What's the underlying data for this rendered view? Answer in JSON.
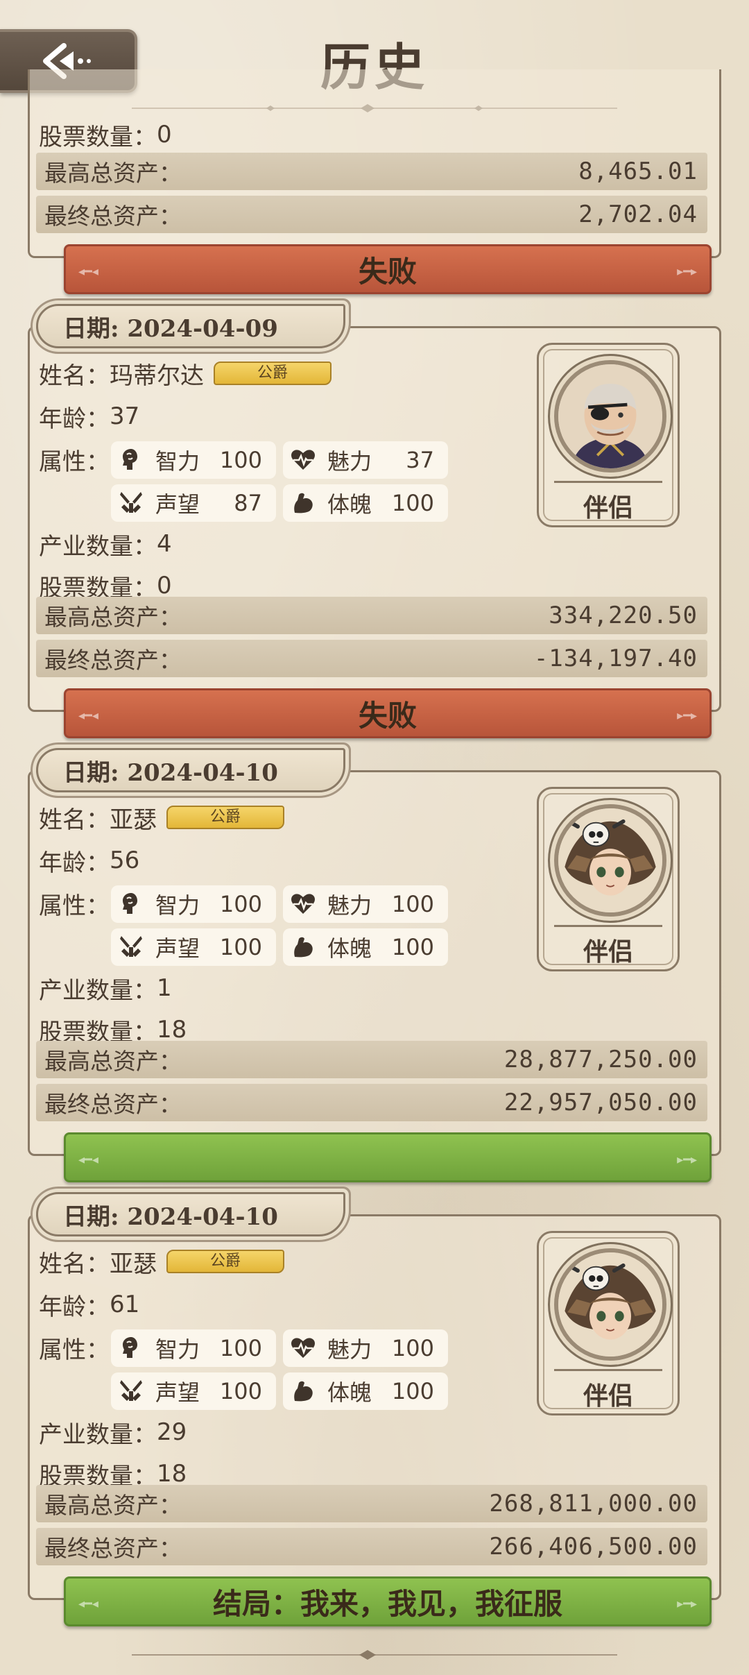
{
  "header": {
    "title": "历史"
  },
  "labels": {
    "name": "姓名：",
    "age": "年龄：",
    "attrs": "属性：",
    "industry": "产业数量：",
    "stock": "股票数量：",
    "max_assets": "最高总资产：",
    "final_assets": "最终总资产：",
    "partner": "伴侣",
    "int": "智力",
    "cha": "魅力",
    "rep": "声望",
    "phy": "体魄"
  },
  "colors": {
    "fail": "#c4603f",
    "win": "#7db345",
    "badge": "#eec74f"
  },
  "records": [
    {
      "stock": "0",
      "max_assets": "8,465.01",
      "final_assets": "2,702.04",
      "result": "失败"
    },
    {
      "date": "日期: 2024-04-09",
      "name": "玛蒂尔达",
      "title": "公爵",
      "age": "37",
      "int": "100",
      "cha": "37",
      "rep": "87",
      "phy": "100",
      "industry": "4",
      "stock": "0",
      "max_assets": "334,220.50",
      "final_assets": "-134,197.40",
      "result": "失败",
      "partner_icon": "eyepatch-man-portrait"
    },
    {
      "date": "日期: 2024-04-10",
      "name": "亚瑟",
      "title": "公爵",
      "age": "56",
      "int": "100",
      "cha": "100",
      "rep": "100",
      "phy": "100",
      "industry": "1",
      "stock": "18",
      "max_assets": "28,877,250.00",
      "final_assets": "22,957,050.00",
      "result": "",
      "partner_icon": "skull-hat-girl-portrait"
    },
    {
      "date": "日期: 2024-04-10",
      "name": "亚瑟",
      "title": "公爵",
      "age": "61",
      "int": "100",
      "cha": "100",
      "rep": "100",
      "phy": "100",
      "industry": "29",
      "stock": "18",
      "max_assets": "268,811,000.00",
      "final_assets": "266,406,500.00",
      "result": "结局：我来，我见，我征服",
      "partner_icon": "skull-hat-girl-portrait"
    }
  ]
}
